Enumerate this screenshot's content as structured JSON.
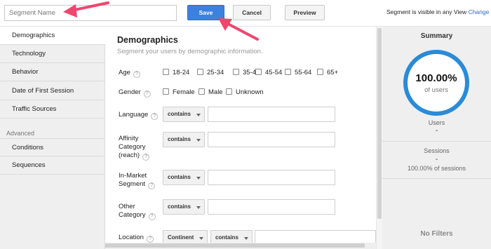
{
  "topbar": {
    "segment_name_placeholder": "Segment Name",
    "save_label": "Save",
    "cancel_label": "Cancel",
    "preview_label": "Preview",
    "visibility_text": "Segment is visible in any View",
    "change_link": "Change"
  },
  "sidebar": {
    "items": [
      {
        "label": "Demographics"
      },
      {
        "label": "Technology"
      },
      {
        "label": "Behavior"
      },
      {
        "label": "Date of First Session"
      },
      {
        "label": "Traffic Sources"
      }
    ],
    "advanced_heading": "Advanced",
    "advanced_items": [
      {
        "label": "Conditions"
      },
      {
        "label": "Sequences"
      }
    ]
  },
  "main": {
    "title": "Demographics",
    "subtitle": "Segment your users by demographic information.",
    "age": {
      "label": "Age",
      "options": [
        "18-24",
        "25-34",
        "35-44",
        "45-54",
        "55-64",
        "65+"
      ]
    },
    "gender": {
      "label": "Gender",
      "options": [
        "Female",
        "Male",
        "Unknown"
      ]
    },
    "language": {
      "label": "Language",
      "operator": "contains"
    },
    "affinity": {
      "label_line1": "Affinity",
      "label_line2": "Category",
      "label_line3": "(reach)",
      "operator": "contains"
    },
    "inmarket": {
      "label_line1": "In-Market",
      "label_line2": "Segment",
      "operator": "contains"
    },
    "other": {
      "label_line1": "Other",
      "label_line2": "Category",
      "operator": "contains"
    },
    "location": {
      "label": "Location",
      "scope": "Continent",
      "operator": "contains"
    },
    "help_glyph": "?"
  },
  "summary": {
    "title": "Summary",
    "percent": "100.00%",
    "percent_label": "of users",
    "users_label": "Users",
    "users_value": "-",
    "sessions_label": "Sessions",
    "sessions_value": "-",
    "sessions_pct": "100.00% of sessions",
    "no_filters": "No Filters"
  },
  "colors": {
    "accent": "#3b82e0",
    "ring": "#2a8bd8",
    "annotation_arrow": "#f0466e"
  },
  "icons": [
    "help-icon",
    "dropdown-caret-icon",
    "checkbox-icon",
    "annotation-arrow-icon"
  ]
}
